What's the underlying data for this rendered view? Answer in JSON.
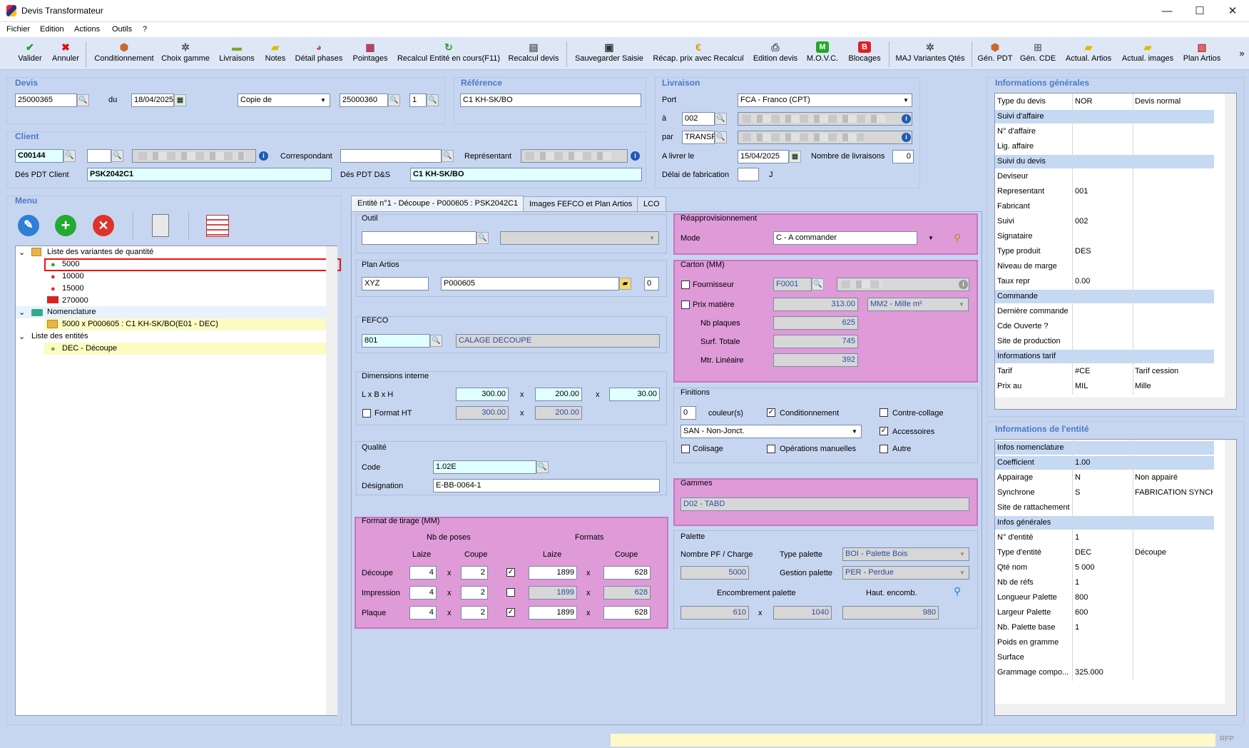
{
  "window": {
    "title": "Devis Transformateur",
    "minimize": "—",
    "maximize": "☐",
    "close": "✕"
  },
  "menu": [
    "Fichier",
    "Edition",
    "Actions",
    "Outils",
    "?"
  ],
  "toolbar": {
    "valider": "Valider",
    "annuler": "Annuler",
    "conditionnement": "Conditionnement",
    "choix_gamme": "Choix gamme",
    "livraisons": "Livraisons",
    "notes": "Notes",
    "detail_phases": "Détail phases",
    "pointages": "Pointages",
    "recalcul_entite": "Recalcul Entité en cours(F11)",
    "recalcul_devis": "Recalcul devis",
    "sauvegarder": "Sauvegarder Saisie",
    "recap": "Récap. prix avec Recalcul",
    "edition_devis": "Edition devis",
    "movc": "M.O.V.C.",
    "blocages": "Blocages",
    "maj_variantes": "MAJ Variantes Qtés",
    "gen_pdt": "Gén. PDT",
    "gen_cde": "Gén. CDE",
    "actual_artios": "Actual. Artios",
    "actual_images": "Actual. images",
    "plan_artios": "Plan Artios",
    "more": "»"
  },
  "devis": {
    "title": "Devis",
    "number": "25000365",
    "du_label": "du",
    "date": "18/04/2025",
    "copie": "Copie de",
    "copie_num": "25000360",
    "copie_idx": "1"
  },
  "reference": {
    "title": "Référence",
    "value": "C1 KH-SK/BO"
  },
  "livraison": {
    "title": "Livraison",
    "port_label": "Port",
    "port": "FCA - Franco (CPT)",
    "a_label": "à",
    "a_value": "002",
    "par_label": "par",
    "par_value": "TRANSP",
    "a_livrer_label": "A livrer le",
    "a_livrer": "15/04/2025",
    "nb_livraisons_label": "Nombre de livraisons",
    "nb_livraisons": "0",
    "delai_label": "Délai de fabrication",
    "delai_value": "",
    "delai_unit": "J"
  },
  "client": {
    "title": "Client",
    "code": "C00144",
    "correspondant_label": "Correspondant",
    "representant_label": "Représentant",
    "des_pdt_client_label": "Dés PDT Client",
    "des_pdt_client": "PSK2042C1",
    "des_pdt_ds_label": "Dés PDT D&S",
    "des_pdt_ds": "C1 KH-SK/BO"
  },
  "menu_panel": {
    "title": "Menu"
  },
  "tree": {
    "variantes": "Liste des variantes de quantité",
    "qty": [
      "5000",
      "10000",
      "15000",
      "270000"
    ],
    "nomenclature": "Nomenclature",
    "nomen_item": "5000 x P000605 : C1 KH-SK/BO(E01 - DEC)",
    "entites": "Liste des entités",
    "entite_item": "DEC - Découpe"
  },
  "tabs": [
    "Entité n°1 - Découpe - P000605 : PSK2042C1",
    "Images FEFCO et Plan Artios",
    "LCO"
  ],
  "outil": {
    "title": "Outil"
  },
  "plan_artios": {
    "title": "Plan Artios",
    "code": "XYZ",
    "ref": "P000605",
    "num": "0"
  },
  "fefco": {
    "title": "FEFCO",
    "code": "801",
    "label": "CALAGE DECOUPE"
  },
  "dimensions": {
    "title": "Dimensions interne",
    "lbh_label": "L x B x H",
    "l": "300.00",
    "b": "200.00",
    "h": "30.00",
    "x": "x",
    "format_ht_label": "Format HT",
    "fl": "300.00",
    "fb": "200.00"
  },
  "qualite": {
    "title": "Qualité",
    "code_label": "Code",
    "code": "1.02E",
    "designation_label": "Désignation",
    "designation": "E-BB-0064-1"
  },
  "format_tirage": {
    "title": "Format de tirage (MM)",
    "nb_poses": "Nb de poses",
    "formats": "Formats",
    "laize": "Laize",
    "coupe": "Coupe",
    "rows": [
      {
        "label": "Découpe",
        "laize": "4",
        "coupe": "2",
        "checked": "✓",
        "flaize": "1899",
        "fcoupe": "628"
      },
      {
        "label": "Impression",
        "laize": "4",
        "coupe": "2",
        "checked": "",
        "flaize": "1899",
        "fcoupe": "628"
      },
      {
        "label": "Plaque",
        "laize": "4",
        "coupe": "2",
        "checked": "✓",
        "flaize": "1899",
        "fcoupe": "628"
      }
    ]
  },
  "reappro": {
    "title": "Réapprovisionnement",
    "mode_label": "Mode",
    "mode": "C - A commander"
  },
  "carton": {
    "title": "Carton (MM)",
    "fournisseur_label": "Fournisseur",
    "fournisseur": "F0001",
    "prix_label": "Prix matière",
    "prix": "313.00",
    "unit": "MM2 - Mille m²",
    "nb_plaques_label": "Nb plaques",
    "nb_plaques": "625",
    "surf_label": "Surf. Totale",
    "surf": "745",
    "mtr_label": "Mtr. Linéaire",
    "mtr": "392"
  },
  "finitions": {
    "title": "Finitions",
    "couleurs_value": "0",
    "couleurs_label": "couleur(s)",
    "conditionnement": "Conditionnement",
    "contre_collage": "Contre-collage",
    "san": "SAN - Non-Jonct.",
    "accessoires": "Accessoires",
    "colisage": "Colisage",
    "operations": "Opérations manuelles",
    "autre": "Autre"
  },
  "gammes": {
    "title": "Gammes",
    "value": "D02 - TABD"
  },
  "palette": {
    "title": "Palette",
    "nb_pf_label": "Nombre PF / Charge",
    "nb_pf": "5000",
    "type_label": "Type palette",
    "type": "BOI - Palette Bois",
    "gestion_label": "Gestion palette",
    "gestion": "PER - Perdue",
    "encombrement_label": "Encombrement palette",
    "haut_label": "Haut. encomb.",
    "e1": "610",
    "e2": "1040",
    "haut": "980"
  },
  "info_gen": {
    "title": "Informations générales",
    "rows": [
      {
        "a": "Type du devis",
        "b": "NOR",
        "c": "Devis normal",
        "h": false
      },
      {
        "a": "Suivi d'affaire",
        "b": "",
        "c": "",
        "h": true
      },
      {
        "a": "N° d'affaire",
        "b": "",
        "c": "",
        "h": false
      },
      {
        "a": "Lig. affaire",
        "b": "",
        "c": "",
        "h": false
      },
      {
        "a": "Suivi du devis",
        "b": "",
        "c": "",
        "h": true
      },
      {
        "a": "Deviseur",
        "b": "",
        "c": "",
        "h": false
      },
      {
        "a": "Representant",
        "b": "001",
        "c": "",
        "h": false
      },
      {
        "a": "Fabricant",
        "b": "",
        "c": "",
        "h": false
      },
      {
        "a": "Suivi",
        "b": "002",
        "c": "",
        "h": false
      },
      {
        "a": "Signataire",
        "b": "",
        "c": "",
        "h": false
      },
      {
        "a": "Type produit",
        "b": "DES",
        "c": "",
        "h": false
      },
      {
        "a": "Niveau de marge",
        "b": "",
        "c": "",
        "h": false
      },
      {
        "a": "Taux repr",
        "b": "0.00",
        "c": "",
        "h": false
      },
      {
        "a": "Commande",
        "b": "",
        "c": "",
        "h": true
      },
      {
        "a": "Dernière commande",
        "b": "",
        "c": "",
        "h": false
      },
      {
        "a": "Cde Ouverte ?",
        "b": "",
        "c": "",
        "h": false
      },
      {
        "a": "Site de production",
        "b": "",
        "c": "",
        "h": false
      },
      {
        "a": "Informations tarif",
        "b": "",
        "c": "",
        "h": true
      },
      {
        "a": "Tarif",
        "b": "#CE",
        "c": "Tarif cession",
        "h": false
      },
      {
        "a": "Prix au",
        "b": "MIL",
        "c": "Mille",
        "h": false
      }
    ]
  },
  "info_ent": {
    "title": "Informations de l'entité",
    "rows": [
      {
        "a": "Infos nomenclature",
        "b": "",
        "c": "",
        "h": true
      },
      {
        "a": "Coefficient",
        "b": "1.00",
        "c": "",
        "h": true
      },
      {
        "a": "Appairage",
        "b": "N",
        "c": "Non appairé",
        "h": false
      },
      {
        "a": "Synchrone",
        "b": "S",
        "c": "FABRICATION SYNCHRONE",
        "h": false
      },
      {
        "a": "Site de rattachement",
        "b": "",
        "c": "",
        "h": false
      },
      {
        "a": "Infos générales",
        "b": "",
        "c": "",
        "h": true
      },
      {
        "a": "N° d'entité",
        "b": "1",
        "c": "",
        "h": false
      },
      {
        "a": "Type d'entité",
        "b": "DEC",
        "c": "Découpe",
        "h": false
      },
      {
        "a": "Qté nom",
        "b": "5 000",
        "c": "",
        "h": false
      },
      {
        "a": "Nb de réfs",
        "b": "1",
        "c": "",
        "h": false
      },
      {
        "a": "Longueur Palette",
        "b": "800",
        "c": "",
        "h": false
      },
      {
        "a": "Largeur Palette",
        "b": "600",
        "c": "",
        "h": false
      },
      {
        "a": "Nb. Palette base",
        "b": "1",
        "c": "",
        "h": false
      },
      {
        "a": "Poids en gramme",
        "b": "",
        "c": "",
        "h": false
      },
      {
        "a": "Surface",
        "b": "",
        "c": "",
        "h": false
      },
      {
        "a": "Grammage compo...",
        "b": "325.000",
        "c": "",
        "h": false
      }
    ]
  },
  "status": {
    "right": "RFP"
  }
}
